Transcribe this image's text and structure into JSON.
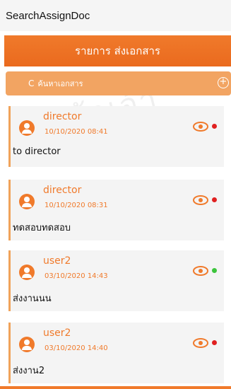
{
  "app": {
    "title": "SearchAssignDoc"
  },
  "header": {
    "title": "รายการ ส่งเอกสาร"
  },
  "search": {
    "icon_glyph": "C",
    "placeholder": "ค้นหาเอกสาร",
    "add_glyph": "+"
  },
  "watermark": {
    "text": "องกล้าเจ้า"
  },
  "colors": {
    "accent": "#f07a2b",
    "status_red": "#e02020",
    "status_green": "#3cc43c"
  },
  "items": [
    {
      "user": "director",
      "timestamp": "10/10/2020 08:41",
      "message": "to director",
      "status": "red"
    },
    {
      "user": "director",
      "timestamp": "10/10/2020 08:31",
      "message": "ทดสอบทดสอบ",
      "status": "red"
    },
    {
      "user": "user2",
      "timestamp": "03/10/2020 14:43",
      "message": "ส่งงานนน",
      "status": "green"
    },
    {
      "user": "user2",
      "timestamp": "03/10/2020 14:40",
      "message": "ส่งงาน2",
      "status": "red"
    }
  ]
}
